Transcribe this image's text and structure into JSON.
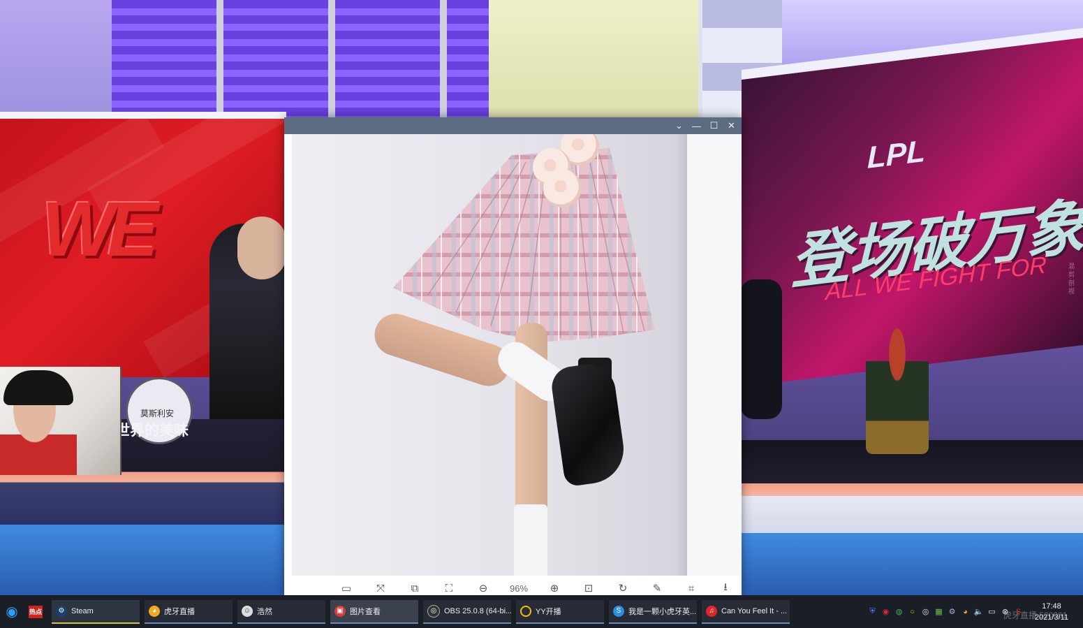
{
  "studio": {
    "left_screen_logo": "WE",
    "right_screen_logo": "LPL",
    "right_screen_title": "登场破万象",
    "right_screen_subtitle": "ALL WE FIGHT FOR",
    "desk_slogan": "世界的美味",
    "sticker_text": "莫斯利安",
    "side_vertical_text": "混·剪·剖·视"
  },
  "viewer": {
    "title": "",
    "titlebar_buttons": [
      {
        "name": "dropdown",
        "glyph": "⌄"
      },
      {
        "name": "minimize",
        "glyph": "—"
      },
      {
        "name": "maximize",
        "glyph": "☐"
      },
      {
        "name": "close",
        "glyph": "✕"
      }
    ],
    "toolbar": {
      "zoom_level": "96%",
      "tools": [
        "presentation-icon",
        "fit-screen-icon",
        "compare-icon",
        "fullscreen-icon",
        "zoom-out-icon",
        "zoom-in-icon",
        "actual-size-icon",
        "rotate-icon",
        "edit-icon",
        "crop-icon",
        "download-icon"
      ]
    }
  },
  "taskbar": {
    "pinned": [
      {
        "name": "browser",
        "label": ""
      },
      {
        "name": "news",
        "label": "热点"
      }
    ],
    "apps": [
      {
        "label": "Steam",
        "icon_color": "#1b3f6e"
      },
      {
        "label": "虎牙直播",
        "icon_color": "#f5a623"
      },
      {
        "label": "浩然",
        "icon_color": "#dddddd"
      },
      {
        "label": "图片查看",
        "icon_color": "#d83b3b"
      },
      {
        "label": "OBS 25.0.8 (64-bi...",
        "icon_color": "#333333"
      },
      {
        "label": "YY开播",
        "icon_color": "#f2c200"
      },
      {
        "label": "我是一颗小虎牙英...",
        "icon_color": "#2a8fe0"
      },
      {
        "label": "Can You Feel It - ...",
        "icon_color": "#e0262c"
      }
    ],
    "clock": {
      "time": "17:48",
      "date": "2021/3/11"
    }
  },
  "watermark": "虎牙直播 520001"
}
